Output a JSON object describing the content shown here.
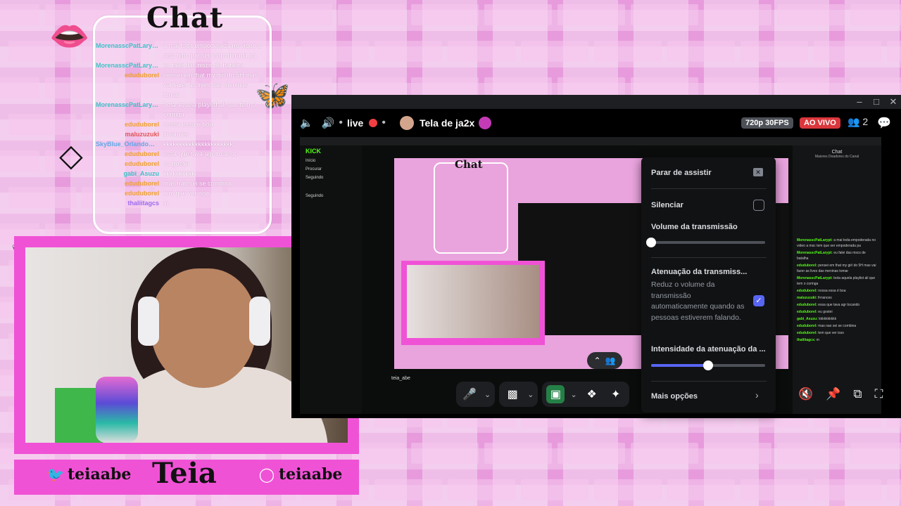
{
  "chat_overlay": {
    "title": "Chat",
    "messages": [
      {
        "user": "MorenasscPatLarypt...",
        "user_color": "#3fc1c9",
        "text": "a mai toda empoderada no video a msc tem que ser empoderada pa"
      },
      {
        "user": "MorenasscPatLarypt...",
        "user_color": "#3fc1c9",
        "text": "eu falei das mscs de batalha"
      },
      {
        "user": "eduduborel",
        "user_color": "#f0a030",
        "text": "pensei em that my girl do 5H mas vai fazer as lives das meninas tomar"
      },
      {
        "user": "MorenasscPatLarypt...",
        "user_color": "#3fc1c9",
        "text": "bota aquela playlist ali que tem o coringa"
      },
      {
        "user": "eduduborel",
        "user_color": "#f0a030",
        "text": "nossa essa é boa"
      },
      {
        "user": "maluzuzuki",
        "user_color": "#e05555",
        "text": "frrrances"
      },
      {
        "user": "SkyBlue_OrlandoBlk...",
        "user_color": "#5fa8e8",
        "text": "kkkkkkkkkkkkkkkkkkkkkk"
      },
      {
        "user": "eduduborel",
        "user_color": "#f0a030",
        "text": "essa que tava agr tocando"
      },
      {
        "user": "eduduborel",
        "user_color": "#f0a030",
        "text": "eu gostei"
      },
      {
        "user": "gabi_Asuzu",
        "user_color": "#3fc1c9",
        "text": "kkkkkkkkkk"
      },
      {
        "user": "eduduborel",
        "user_color": "#f0a030",
        "text": "mas nao sei se combina"
      },
      {
        "user": "eduduborel",
        "user_color": "#f0a030",
        "text": "tem que ver isso"
      },
      {
        "user": "thaliitagcs",
        "user_color": "#9b6bf0",
        "text": "m"
      }
    ]
  },
  "socials": {
    "twitter_handle": "teiaabe",
    "logo_text": "Teia",
    "instagram_handle": "teiaabe"
  },
  "discord": {
    "channel_label": "live",
    "stream_title": "Tela de ja2x",
    "quality_badge": "720p 30FPS",
    "live_badge": "AO VIVO",
    "viewer_count": "2",
    "shared_screen": {
      "kick_logo": "KICK",
      "nav": [
        "Início",
        "Procurar",
        "Seguindo"
      ],
      "following_label": "Seguindo",
      "nested_chat_title": "Chat",
      "streamer_name": "teia_abe",
      "right_chat_title": "Chat",
      "right_chat_sub": "Maiores Doadores do Canal",
      "right_chat_lines": [
        {
          "user": "MorenasscPatLarypt:",
          "text": "a mai toda empoderada no video a msc tem que ser empoderada pa"
        },
        {
          "user": "MorenasscPatLarypt:",
          "text": "eu falei das mscs de batalha"
        },
        {
          "user": "eduduborel:",
          "text": "pensei em that my girl do 5H mas vai fazer as lives das meninas tomar"
        },
        {
          "user": "MorenasscPatLarypt:",
          "text": "bota aquela playlist ali que tem o coringa"
        },
        {
          "user": "eduduborel:",
          "text": "nossa essa é boa"
        },
        {
          "user": "maluzuzuki:",
          "text": "frrrances"
        },
        {
          "user": "eduduborel:",
          "text": "essa que tava agr tocando"
        },
        {
          "user": "eduduborel:",
          "text": "eu gostei"
        },
        {
          "user": "gabi_Asuzu:",
          "text": "kkkkkkkkkk"
        },
        {
          "user": "eduduborel:",
          "text": "mas nao sei se combina"
        },
        {
          "user": "eduduborel:",
          "text": "tem que ver isso"
        },
        {
          "user": "thaliitagcs:",
          "text": "m"
        }
      ]
    },
    "popup": {
      "stop_watching": "Parar de assistir",
      "mute": "Silenciar",
      "mute_checked": false,
      "stream_volume_label": "Volume da transmissão",
      "stream_volume": 0.0,
      "attenuation_label": "Atenuação da transmiss...",
      "attenuation_desc": "Reduz o volume da transmissão automaticamente quando as pessoas estiverem falando.",
      "attenuation_checked": true,
      "attenuation_intensity_label": "Intensidade da atenuação da ...",
      "attenuation_intensity": 0.5,
      "more_options": "Mais opções"
    }
  }
}
